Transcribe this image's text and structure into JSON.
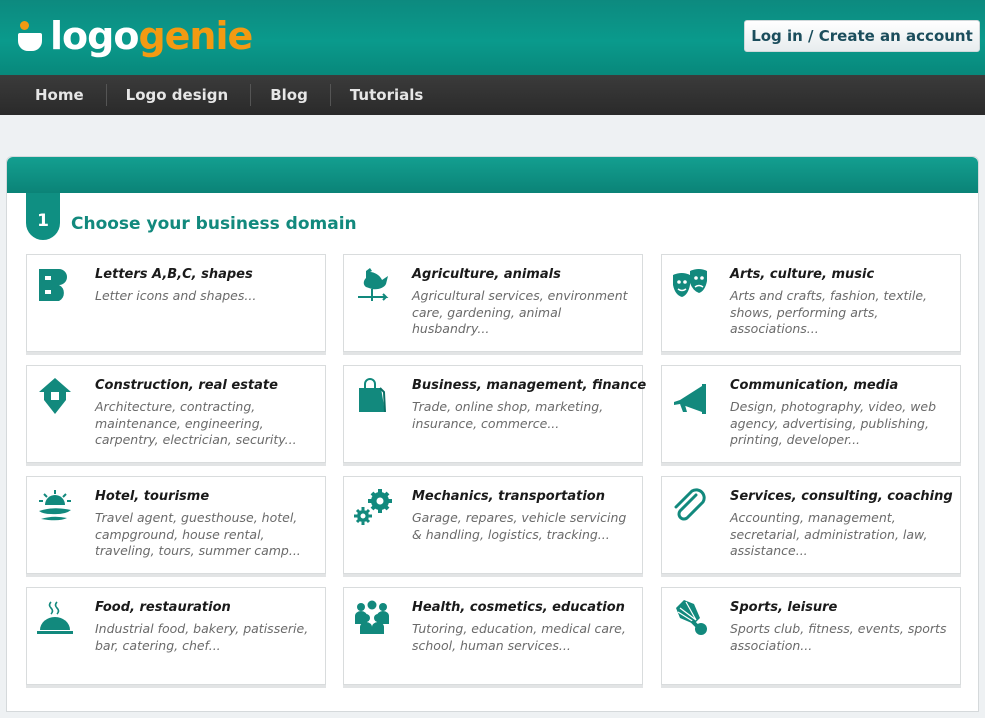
{
  "header": {
    "logo_part1": "logo",
    "logo_part2": "genie",
    "login_label": "Log in / Create an account",
    "brand_color": "#0a9a8c",
    "accent_color": "#f39a12"
  },
  "nav": {
    "items": [
      {
        "label": "Home"
      },
      {
        "label": "Logo design"
      },
      {
        "label": "Blog"
      },
      {
        "label": "Tutorials"
      }
    ]
  },
  "step": {
    "number": "1",
    "title": "Choose your business domain"
  },
  "categories": [
    {
      "icon": "letter-b-icon",
      "title": "Letters A,B,C, shapes",
      "desc": "Letter icons and shapes..."
    },
    {
      "icon": "rooster-weathervane-icon",
      "title": "Agriculture, animals",
      "desc": "Agricultural services, environment care, gardening, animal husbandry..."
    },
    {
      "icon": "theater-masks-icon",
      "title": "Arts, culture, music",
      "desc": "Arts and crafts, fashion, textile, shows, performing arts, associations..."
    },
    {
      "icon": "house-pin-icon",
      "title": "Construction, real estate",
      "desc": "Architecture, contracting, maintenance, engineering, carpentry, electrician, security..."
    },
    {
      "icon": "shopping-bag-icon",
      "title": "Business, management, finance",
      "desc": "Trade, online shop, marketing, insurance, commerce..."
    },
    {
      "icon": "megaphone-icon",
      "title": "Communication, media",
      "desc": "Design, photography, video, web agency, advertising, publishing, printing, developer..."
    },
    {
      "icon": "sunset-island-icon",
      "title": "Hotel, tourisme",
      "desc": "Travel agent, guesthouse, hotel, campground, house rental, traveling, tours, summer camp..."
    },
    {
      "icon": "gears-icon",
      "title": "Mechanics, transportation",
      "desc": "Garage, repares, vehicle servicing & handling, logistics, tracking..."
    },
    {
      "icon": "paperclip-icon",
      "title": "Services, consulting, coaching",
      "desc": "Accounting, management, secretarial, administration, law, assistance..."
    },
    {
      "icon": "cloche-icon",
      "title": "Food, restauration",
      "desc": "Industrial food, bakery, patisserie, bar, catering, chef..."
    },
    {
      "icon": "people-group-icon",
      "title": "Health, cosmetics, education",
      "desc": "Tutoring, education, medical care, school, human services..."
    },
    {
      "icon": "shuttlecock-icon",
      "title": "Sports, leisure",
      "desc": "Sports club, fitness, events, sports association..."
    }
  ]
}
